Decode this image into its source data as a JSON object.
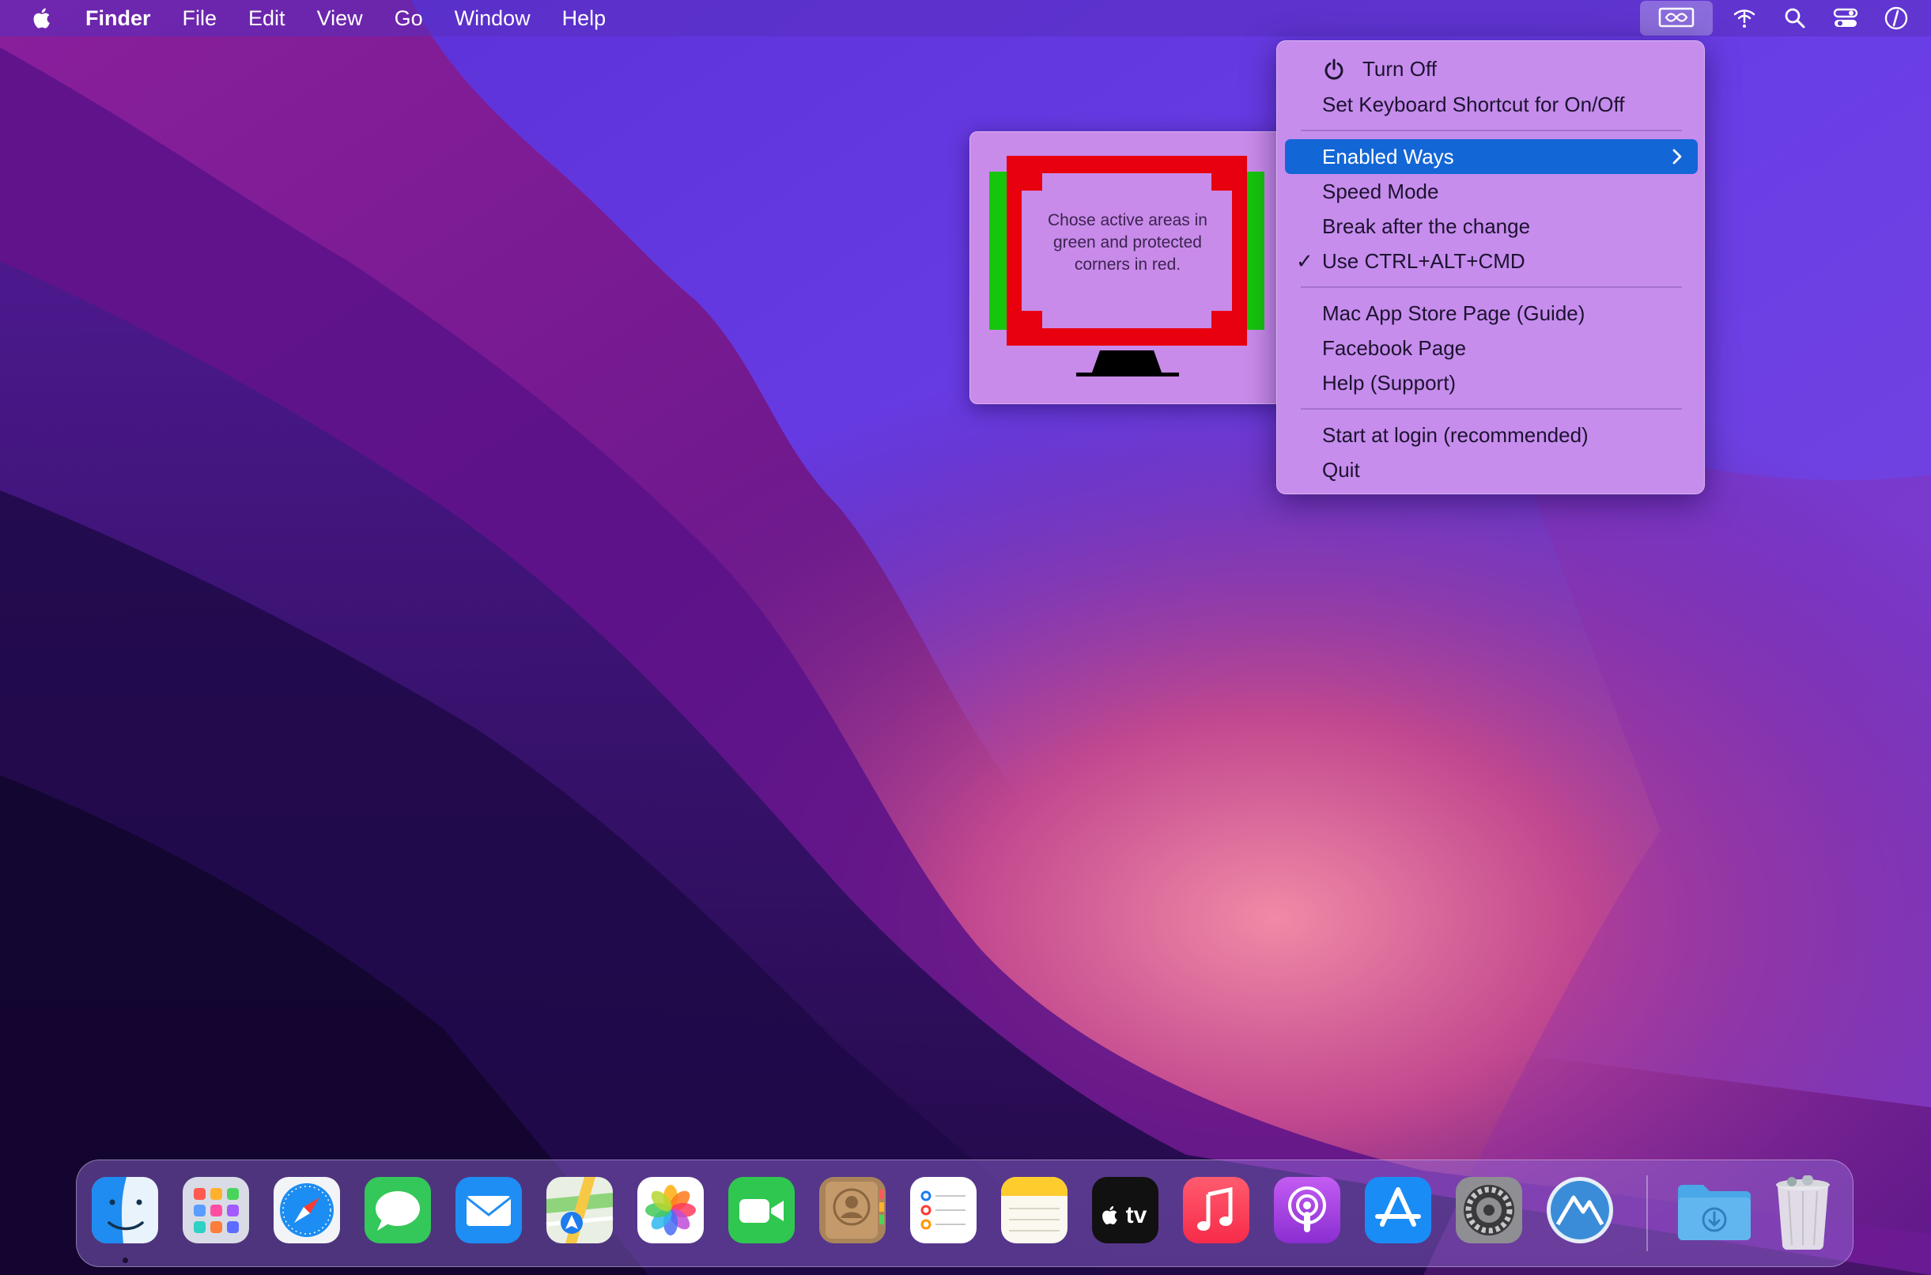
{
  "menubar": {
    "app_name": "Finder",
    "menus": [
      "File",
      "Edit",
      "View",
      "Go",
      "Window",
      "Help"
    ],
    "status_icons": [
      "app-status-icon",
      "wifi-icon",
      "search-icon",
      "control-center-icon",
      "siri-icon"
    ]
  },
  "info_popover": {
    "text": "Chose active areas in green and protected corners in red.",
    "active_color": "#16c60c",
    "protected_color": "#e8000f"
  },
  "menu": {
    "items": [
      {
        "label": "Turn Off",
        "icon": "power-icon"
      },
      {
        "label": "Set Keyboard Shortcut for On/Off"
      },
      {
        "label": "Enabled Ways",
        "selected": true,
        "submenu": true
      },
      {
        "label": "Speed Mode"
      },
      {
        "label": "Break after the change"
      },
      {
        "label": "Use CTRL+ALT+CMD",
        "checked": true,
        "check_mark": "✓"
      },
      {
        "label": "Mac App Store Page (Guide)"
      },
      {
        "label": "Facebook Page"
      },
      {
        "label": "Help (Support)"
      },
      {
        "label": "Start at login (recommended)"
      },
      {
        "label": "Quit"
      }
    ],
    "selected_color": "#1366d6"
  },
  "dock": {
    "apps": [
      "Finder",
      "Launchpad",
      "Safari",
      "Messages",
      "Mail",
      "Maps",
      "Photos",
      "FaceTime",
      "Contacts",
      "Reminders",
      "Notes",
      "TV",
      "Music",
      "Podcasts",
      "App Store",
      "System Preferences",
      "Hot Corner App",
      "Downloads",
      "Trash"
    ],
    "tv_label": "tv"
  }
}
